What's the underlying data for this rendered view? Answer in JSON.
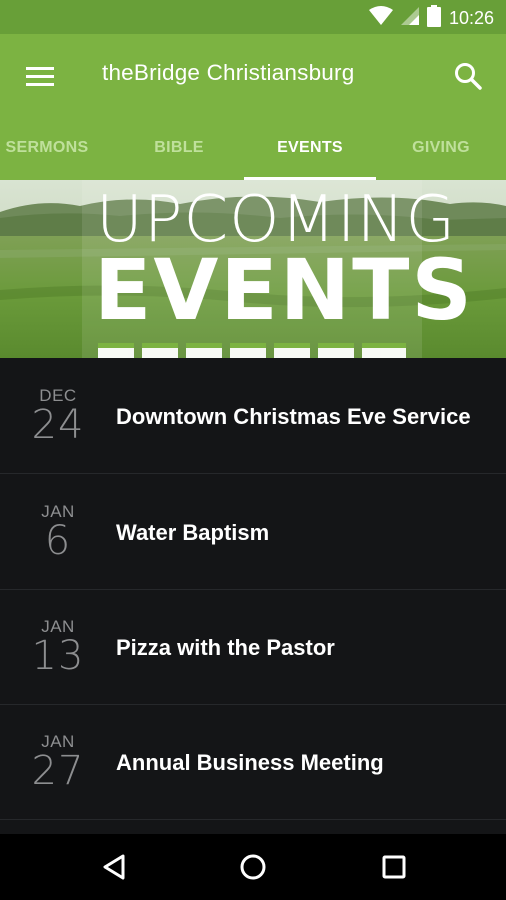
{
  "status_bar": {
    "time": "10:26",
    "icons": [
      "wifi-icon",
      "signal-icon",
      "battery-icon"
    ]
  },
  "app_bar": {
    "title": "theBridge Christiansburg",
    "icons": [
      "menu-icon",
      "search-icon"
    ]
  },
  "tabs": [
    {
      "label": "SERMONS",
      "active": false
    },
    {
      "label": "BIBLE",
      "active": false
    },
    {
      "label": "EVENTS",
      "active": true
    },
    {
      "label": "GIVING",
      "active": false
    }
  ],
  "banner": {
    "line1": "UPCOMING",
    "line2": "EVENTS"
  },
  "events": [
    {
      "month": "DEC",
      "day": "24",
      "title": "Downtown Christmas Eve Service"
    },
    {
      "month": "JAN",
      "day": "6",
      "title": "Water Baptism"
    },
    {
      "month": "JAN",
      "day": "13",
      "title": "Pizza with the Pastor"
    },
    {
      "month": "JAN",
      "day": "27",
      "title": "Annual Business Meeting"
    }
  ],
  "nav_bar": {
    "icons": [
      "back-icon",
      "home-icon",
      "recents-icon"
    ]
  },
  "colors": {
    "status_bar": "#689f38",
    "app_bar": "#7cb342",
    "list_background": "#141517",
    "date_text": "#8d8e90"
  }
}
